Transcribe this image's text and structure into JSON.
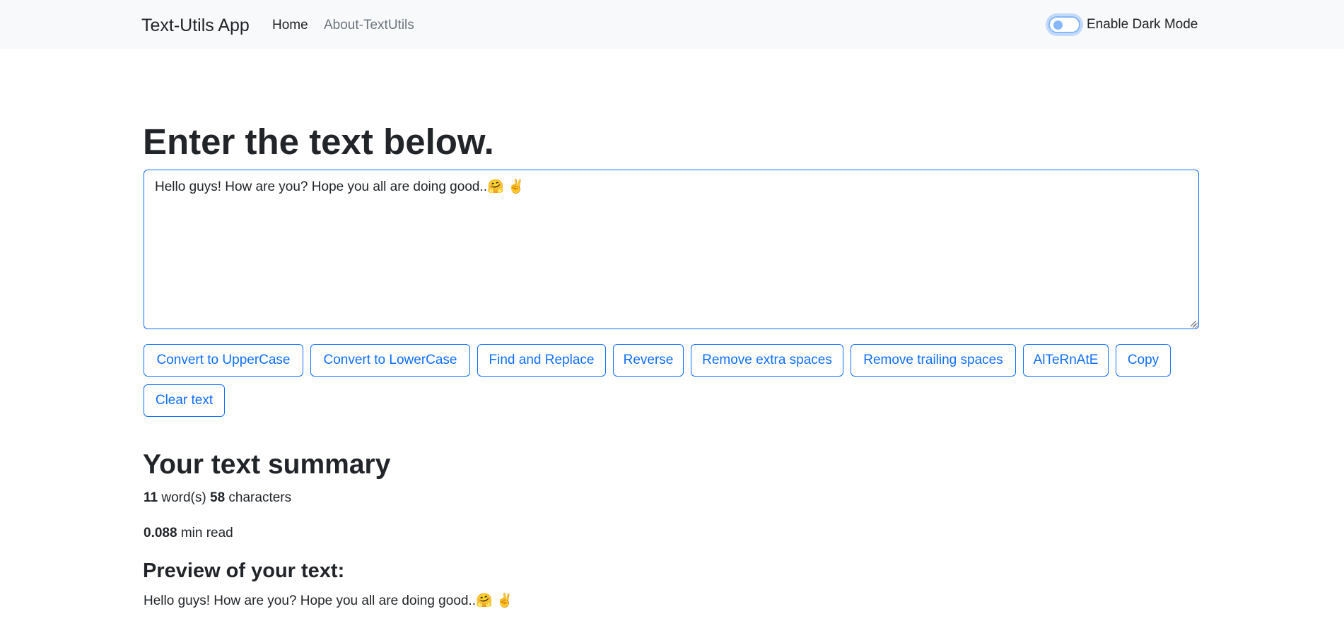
{
  "navbar": {
    "brand": "Text-Utils App",
    "links": [
      {
        "label": "Home",
        "active": true
      },
      {
        "label": "About-TextUtils",
        "active": false
      }
    ],
    "dark_mode": {
      "label": "Enable Dark Mode",
      "checked": false
    }
  },
  "main": {
    "heading": "Enter the text below.",
    "textarea_value": "Hello guys! How are you? Hope you all are doing good..🤗 ✌️",
    "buttons": [
      "Convert to UpperCase",
      "Convert to LowerCase",
      "Find and Replace",
      "Reverse",
      "Remove extra spaces",
      "Remove trailing spaces",
      "AlTeRnAtE",
      "Copy",
      "Clear text"
    ]
  },
  "summary": {
    "heading": "Your text summary",
    "word_count": "11",
    "word_label": "word(s)",
    "char_count": "58",
    "char_label": "characters",
    "read_time": "0.088",
    "read_label": "min read",
    "preview_heading": "Preview of your text:",
    "preview_text": "Hello guys! How are you? Hope you all are doing good..🤗 ✌️"
  },
  "colors": {
    "primary": "#0d6efd",
    "navbar_bg": "#f8f9fa",
    "text": "#212529",
    "muted": "#6c757d"
  }
}
